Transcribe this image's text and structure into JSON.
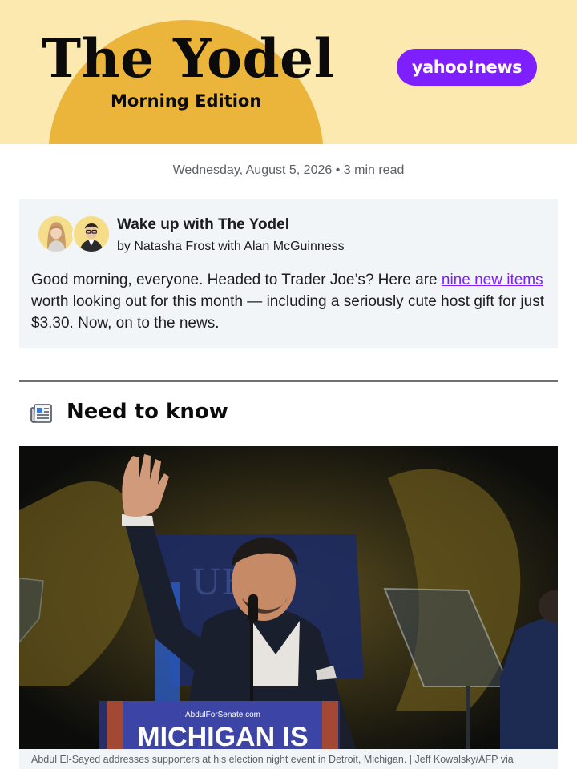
{
  "header": {
    "title": "The Yodel",
    "subtitle": "Morning Edition",
    "brand": "yahoo!news",
    "colors": {
      "background": "#fbe9b0",
      "sun": "#ebb53c",
      "brand": "#7e1fff"
    }
  },
  "meta": {
    "date": "Wednesday, August 5, 2026",
    "separator": " • ",
    "read_time": "3 min read"
  },
  "intro": {
    "title": "Wake up with The Yodel",
    "byline": "by Natasha Frost with Alan McGuinness",
    "body_before": "Good morning, everyone. Headed to Trader Joe’s? Here are ",
    "link_text": "nine new items",
    "body_after": " worth looking out for this month — including a seriously cute host gift for just $3.30. Now, on to the news."
  },
  "section": {
    "icon": "newspaper-icon",
    "title": "Need to know"
  },
  "photo": {
    "sign_url": "AbdulForSenate.com",
    "sign_text": "MICHIGAN IS",
    "backdrop_text": "UE",
    "caption": "Abdul El-Sayed addresses supporters at his election night event in Detroit, Michigan. | Jeff Kowalsky/AFP via"
  }
}
